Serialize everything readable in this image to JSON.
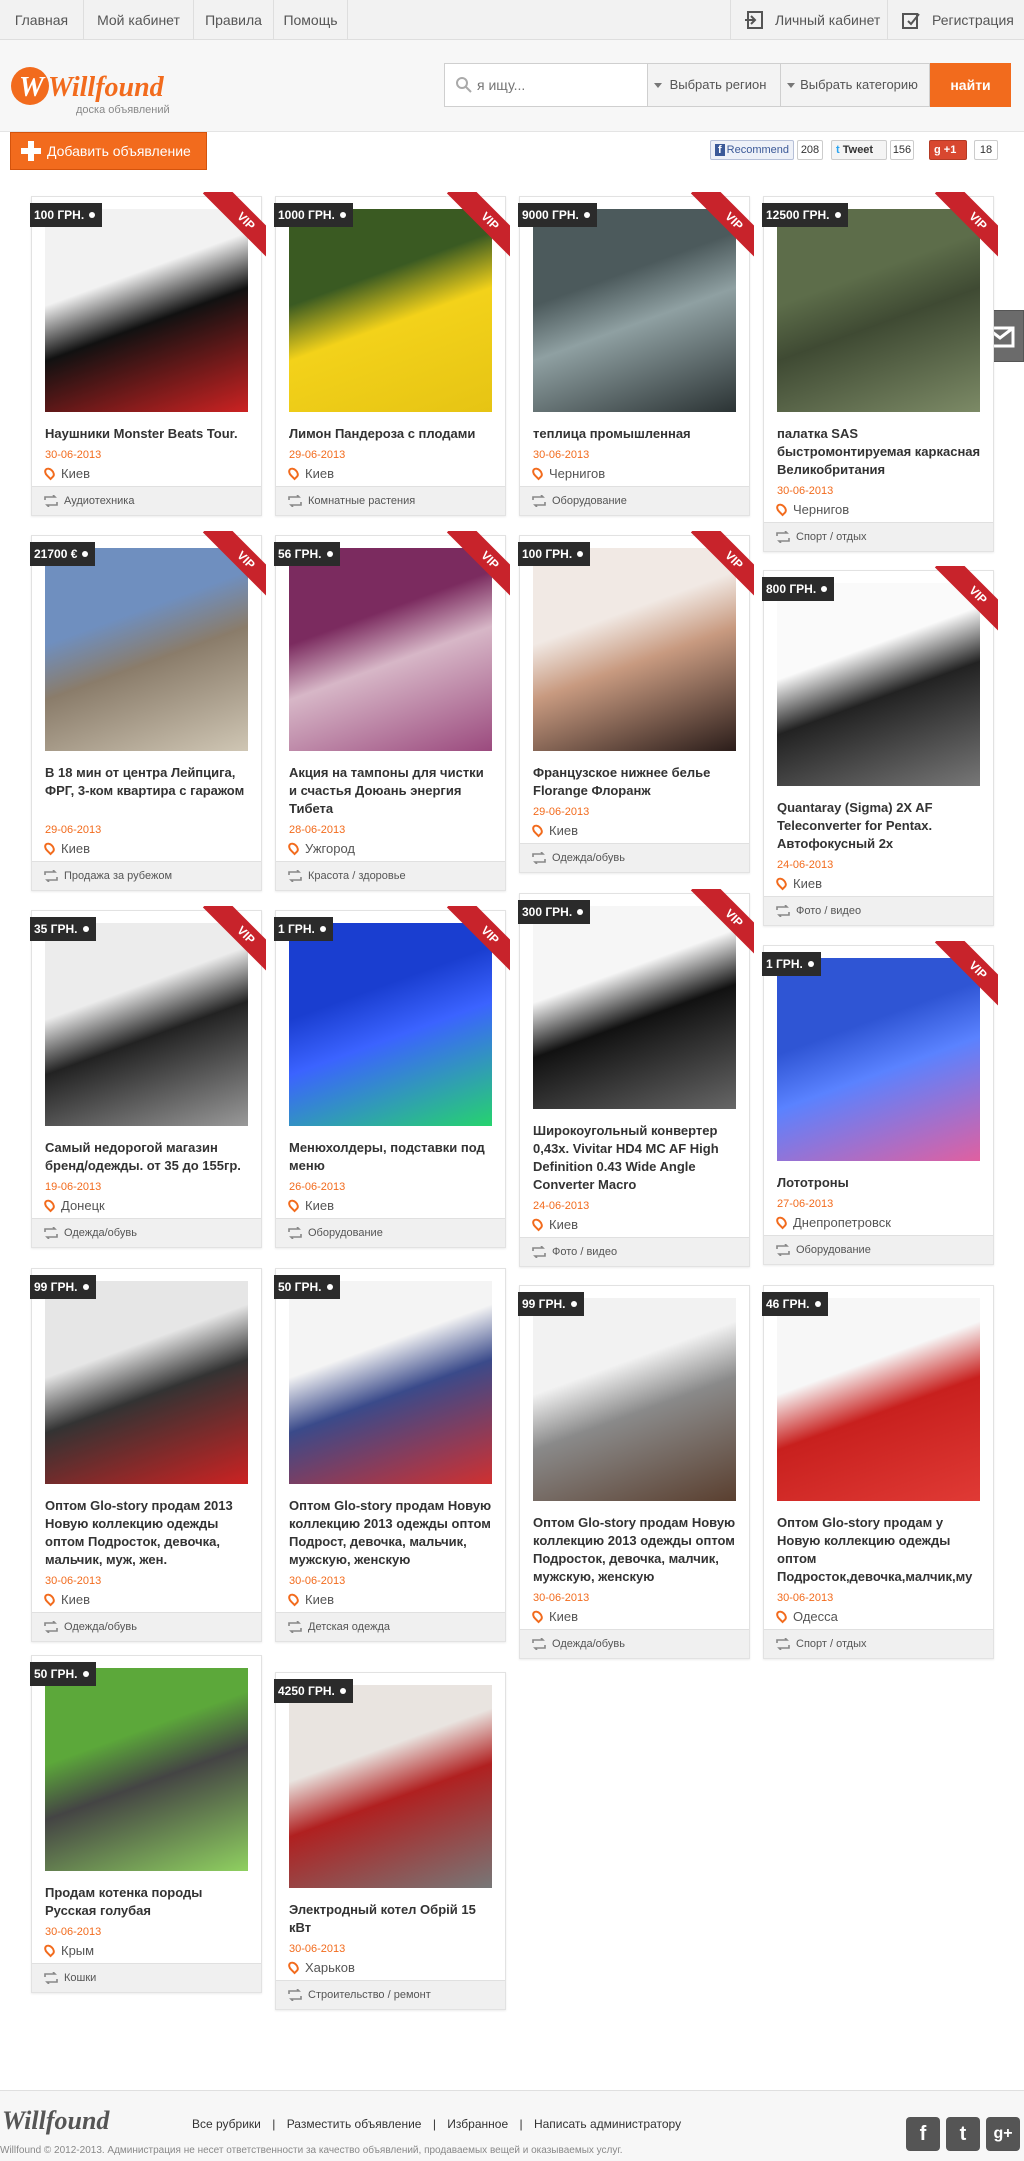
{
  "nav": {
    "home": "Главная",
    "cabinet": "Мой кабинет",
    "rules": "Правила",
    "help": "Помощь",
    "personal": "Личный кабинет",
    "register": "Регистрация"
  },
  "logo": {
    "name": "Willfound",
    "tagline": "доска объявлений"
  },
  "search": {
    "placeholder": "я ищу...",
    "region": "Выбрать регион",
    "category": "Выбрать категорию",
    "button": "найти"
  },
  "add_button": "Добавить объявление",
  "social": {
    "fb_label": "Recommend",
    "fb_count": "208",
    "tw_label": "Tweet",
    "tw_count": "156",
    "gp_label": "+1",
    "gp_count": "18"
  },
  "vip_label": "VIP",
  "listings": [
    {
      "price": "100 ГРН.",
      "title": "Наушники Monster Beats Tour.",
      "date": "30-06-2013",
      "city": "Киев",
      "category": "Аудиотехника",
      "vip": true
    },
    {
      "price": "1000 ГРН.",
      "title": "Лимон Пандероза с плодами",
      "date": "29-06-2013",
      "city": "Киев",
      "category": "Комнатные растения",
      "vip": true
    },
    {
      "price": "9000 ГРН.",
      "title": "теплица промышленная",
      "date": "30-06-2013",
      "city": "Чернигов",
      "category": "Оборудование",
      "vip": true
    },
    {
      "price": "12500 ГРН.",
      "title": "палатка SAS быстромонтируемая каркасная Великобритания",
      "date": "30-06-2013",
      "city": "Чернигов",
      "category": "Спорт / отдых",
      "vip": true
    },
    {
      "price": "21700 €",
      "title": "В 18 мин от центра Лейпцига, ФРГ, 3-ком квартира с гаражом",
      "date": "29-06-2013",
      "city": "Киев",
      "category": "Продажа за рубежом",
      "vip": true
    },
    {
      "price": "56 ГРН.",
      "title": "Акция на тампоны для чистки и счастья Доюань энергия Тибета",
      "date": "28-06-2013",
      "city": "Ужгород",
      "category": "Красота / здоровье",
      "vip": true
    },
    {
      "price": "100 ГРН.",
      "title": "Французское нижнее белье Florange Флоранж",
      "date": "29-06-2013",
      "city": "Киев",
      "category": "Одежда/обувь",
      "vip": true
    },
    {
      "price": "800 ГРН.",
      "title": "Quantaray (Sigma) 2X AF Teleconverter for Pentax. Автофокусный 2х",
      "date": "24-06-2013",
      "city": "Киев",
      "category": "Фото / видео",
      "vip": true
    },
    {
      "price": "35 ГРН.",
      "title": "Самый недорогой магазин бренд/одежды. от 35 до 155гр.",
      "date": "19-06-2013",
      "city": "Донецк",
      "category": "Одежда/обувь",
      "vip": true
    },
    {
      "price": "1 ГРН.",
      "title": "Менюхолдеры, подставки под меню",
      "date": "26-06-2013",
      "city": "Киев",
      "category": "Оборудование",
      "vip": true
    },
    {
      "price": "300 ГРН.",
      "title": "Широкоугольный конвертер 0,43x. Vivitar HD4 MC AF High Definition 0.43 Wide Angle Converter Macro",
      "date": "24-06-2013",
      "city": "Киев",
      "category": "Фото / видео",
      "vip": true
    },
    {
      "price": "1 ГРН.",
      "title": "Лототроны",
      "date": "27-06-2013",
      "city": "Днепропетровск",
      "category": "Оборудование",
      "vip": true
    },
    {
      "price": "99 ГРН.",
      "title": "Оптом Glo-story продам 2013 Новую коллекцию одежды оптом Подросток, девочка, мальчик, муж, жен.",
      "date": "30-06-2013",
      "city": "Киев",
      "category": "Одежда/обувь",
      "vip": false
    },
    {
      "price": "50 ГРН.",
      "title": "Оптом Glo-story продам Новую коллекцию 2013 одежды оптом Подрост, девочка, мальчик, мужскую, женскую",
      "date": "30-06-2013",
      "city": "Киев",
      "category": "Детская одежда",
      "vip": false
    },
    {
      "price": "99 ГРН.",
      "title": "Оптом Glo-story продам Новую коллекцию 2013 одежды оптом Подросток, девочка, малчик, мужскую, женскую",
      "date": "30-06-2013",
      "city": "Киев",
      "category": "Одежда/обувь",
      "vip": false
    },
    {
      "price": "46 ГРН.",
      "title": "Оптом Glo-story продам у Новую коллекцию одежды оптом Подросток,девочка,малчик,му",
      "date": "30-06-2013",
      "city": "Одесса",
      "category": "Спорт / отдых",
      "vip": false
    },
    {
      "price": "50 ГРН.",
      "title": "Продам котенка породы Русская голубая",
      "date": "30-06-2013",
      "city": "Крым",
      "category": "Кошки",
      "vip": false
    },
    {
      "price": "4250 ГРН.",
      "title": "Электродный котел Обрій 15 кВт",
      "date": "30-06-2013",
      "city": "Харьков",
      "category": "Строительство / ремонт",
      "vip": false
    }
  ],
  "footer": {
    "links": [
      "Все рубрики",
      "|",
      "Разместить объявление",
      "|",
      "Избранное",
      "|",
      "Написать администратору"
    ],
    "copyright": "Willfound © 2012-2013. Администрация не несет ответственности за качество объявлений, продаваемых вещей и оказываемых услуг."
  }
}
